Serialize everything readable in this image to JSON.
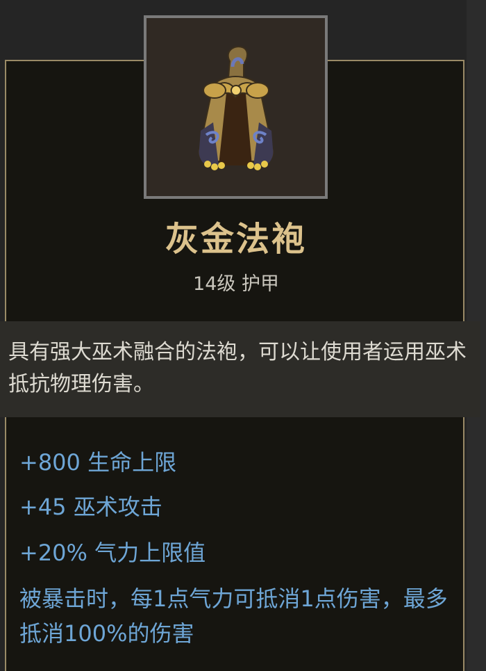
{
  "item": {
    "icon_name": "robe-icon",
    "name": "灰金法袍",
    "meta": "14级 护甲",
    "description": "具有强大巫术融合的法袍，可以让使用者运用巫术抵抗物理伤害。",
    "stats": [
      "+800 生命上限",
      "+45 巫术攻击",
      "+20% 气力上限值"
    ],
    "effect": "被暴击时，每1点气力可抵消1点伤害，最多抵消100%的伤害"
  },
  "colors": {
    "name": "#dcc28c",
    "stat": "#6ea6d6",
    "border": "#9a8a66"
  }
}
